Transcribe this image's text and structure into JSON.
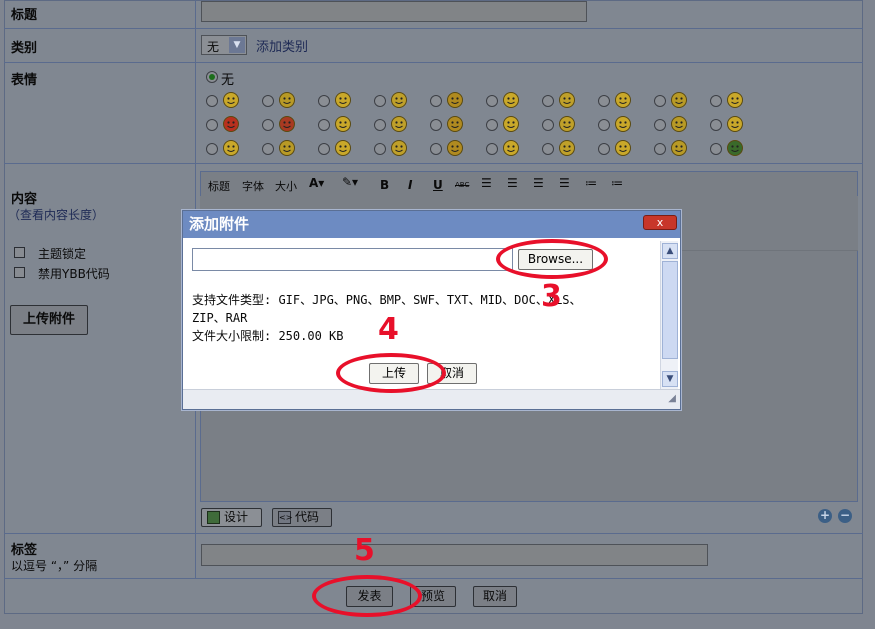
{
  "form": {
    "title_label": "标题",
    "category_label": "类别",
    "category_value": "无",
    "add_category_link": "添加类别",
    "emotion_label": "表情",
    "emotion_none": "无",
    "content_label": "内容",
    "content_length_link": "（查看内容长度）",
    "topic_lock": "主题锁定",
    "disable_ybb": "禁用YBB代码",
    "upload_attachment": "上传附件",
    "tags_label": "标签",
    "tags_hint": "以逗号 “，” 分隔",
    "submit": "发表",
    "preview": "预览",
    "cancel": "取消"
  },
  "editor": {
    "toolbar": [
      "标题",
      "字体",
      "大小"
    ],
    "design_tab": "设计",
    "code_tab": "代码",
    "bold": "B",
    "italic": "I",
    "underline": "U",
    "strike": "ABC"
  },
  "dialog": {
    "title": "添加附件",
    "browse": "Browse...",
    "file_types_line1": "支持文件类型: GIF、JPG、PNG、BMP、SWF、TXT、MID、DOC、XLS、",
    "file_types_line2": "ZIP、RAR",
    "size_limit": "文件大小限制: 250.00 KB",
    "upload": "上传",
    "cancel": "取消",
    "close": "x"
  },
  "annotations": [
    "3",
    "4",
    "5"
  ],
  "colors": {
    "annotation": "#e8102a",
    "dialog_title_bg": "#6d8bc2",
    "overlay_bg": "#808791"
  }
}
